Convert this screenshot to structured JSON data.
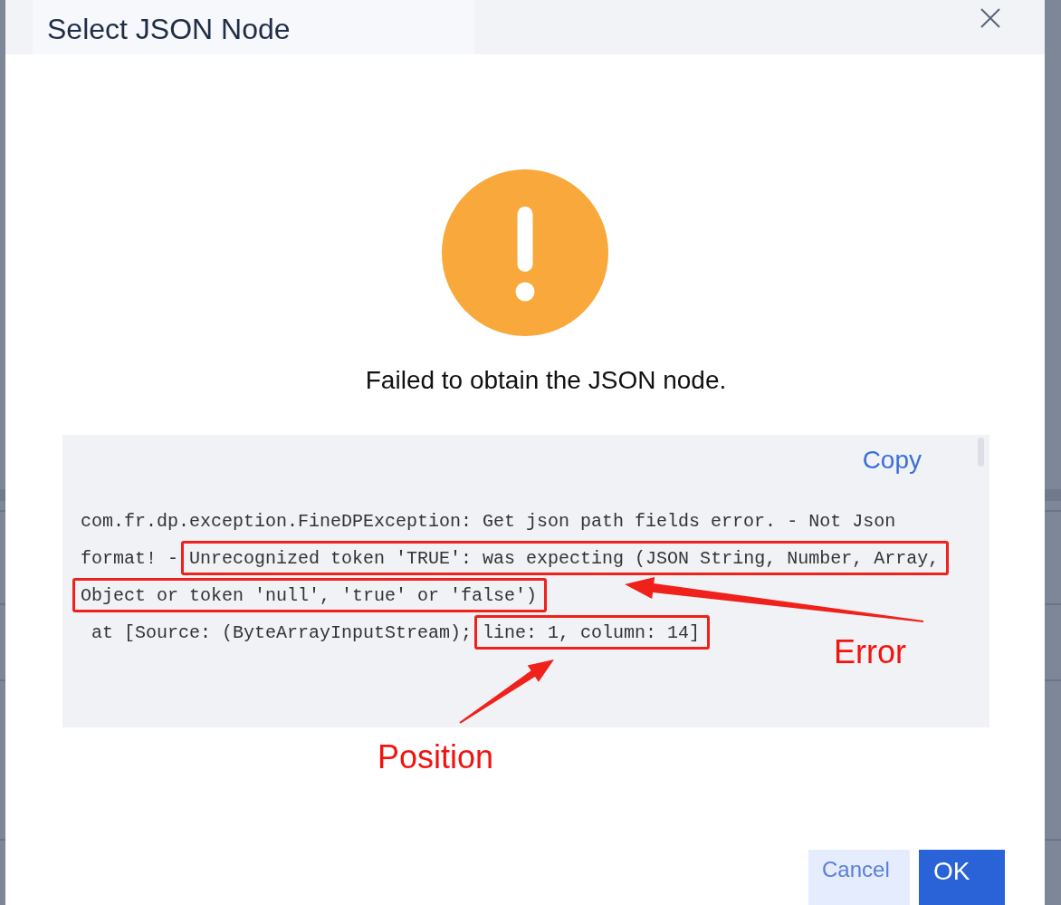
{
  "dialog": {
    "title": "Select JSON Node"
  },
  "alert": {
    "message": "Failed to obtain the JSON node."
  },
  "details": {
    "copy_link": "Copy",
    "lines": [
      {
        "segments": [
          {
            "text": "com.fr.dp.exception.FineDPException: Get json path fields error. - Not Json",
            "boxed": false
          }
        ]
      },
      {
        "segments": [
          {
            "text": "format! - ",
            "boxed": false
          },
          {
            "text": "Unrecognized token 'TRUE': was expecting (JSON String, Number, Array,",
            "boxed": true
          }
        ]
      },
      {
        "segments": [
          {
            "text": "Object or token 'null', 'true' or 'false')",
            "boxed": true
          }
        ]
      },
      {
        "segments": [
          {
            "text": " at [Source: (ByteArrayInputStream); ",
            "boxed": false
          },
          {
            "text": "line: 1, column: 14]",
            "boxed": true
          }
        ]
      }
    ]
  },
  "callouts": [
    {
      "label": "Error"
    },
    {
      "label": "Position"
    }
  ],
  "buttons": [
    {
      "label": "Cancel",
      "kind": "secondary"
    },
    {
      "label": "OK",
      "kind": "primary"
    }
  ]
}
